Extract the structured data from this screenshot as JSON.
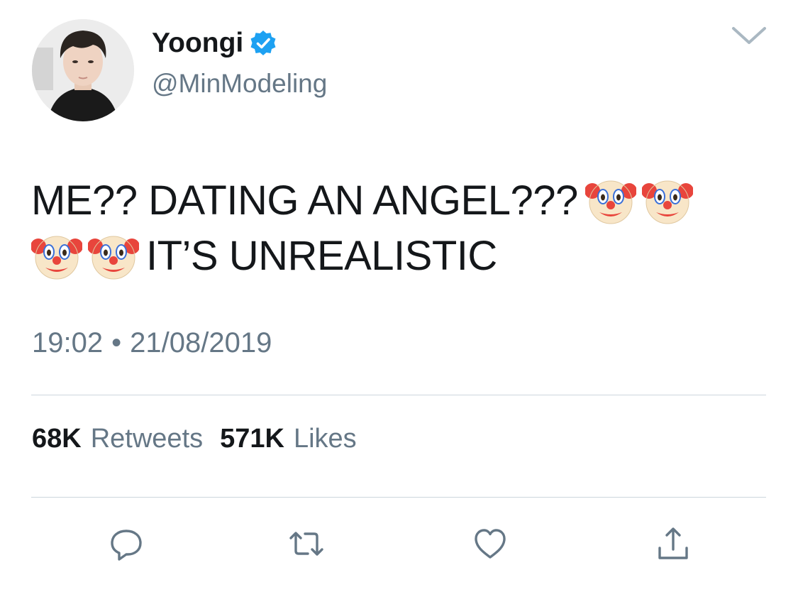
{
  "tweet": {
    "author": {
      "display_name": "Yoongi",
      "handle": "@MinModeling",
      "verified": true
    },
    "text_line1": "ME?? DATING AN ANGEL???",
    "text_line2": "IT’S UNREALISTIC",
    "emoji": "clown-face",
    "time": "19:02",
    "separator": "•",
    "date": "21/08/2019",
    "stats": {
      "retweets_count": "68K",
      "retweets_label": "Retweets",
      "likes_count": "571K",
      "likes_label": "Likes"
    }
  },
  "colors": {
    "text": "#14171a",
    "secondary": "#657786",
    "verified": "#1da1f2",
    "divider": "#ccd6dd"
  },
  "icons": {
    "reply": "reply-icon",
    "retweet": "retweet-icon",
    "like": "like-icon",
    "share": "share-icon",
    "caret": "chevron-down-icon"
  }
}
